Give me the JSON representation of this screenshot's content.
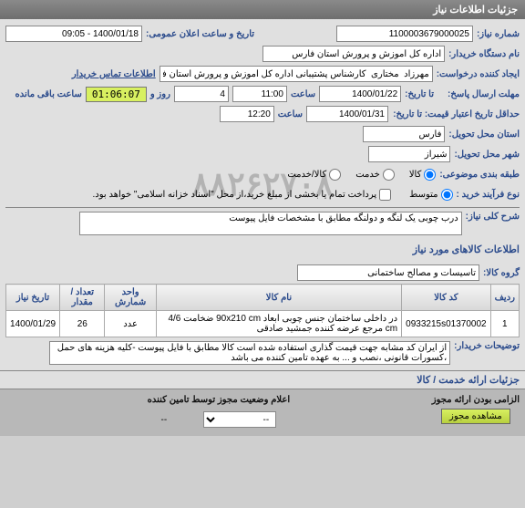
{
  "titlebar": "جزئیات اطلاعات نیاز",
  "need_no_label": "شماره نیاز:",
  "need_no": "1100003679000025",
  "announce_label": "تاریخ و ساعت اعلان عمومی:",
  "announce_value": "1400/01/18 - 09:05",
  "buyer_label": "نام دستگاه خریدار:",
  "buyer_value": "اداره کل آموزش و پرورش استان فارس",
  "creator_label": "ایجاد کننده درخواست:",
  "creator_value": "مهرزاد  مختاری  کارشناس پشتیبانی اداره کل آموزش و پرورش استان فارس",
  "contact_link": "اطلاعات تماس خریدار",
  "deadline_reply_label": "مهلت ارسال پاسخ:",
  "deadline_reply_to_label": "تا تاریخ:",
  "deadline_reply_date": "1400/01/22",
  "time_label": "ساعت",
  "deadline_reply_time": "11:00",
  "deadline_reply_days": "4",
  "days_and_label": "روز و",
  "deadline_reply_clock": "01:06:07",
  "clock_suffix": "ساعت باقی مانده",
  "price_valid_label": "حداقل تاریخ اعتبار قیمت: تا تاریخ:",
  "price_valid_date": "1400/01/31",
  "price_valid_time": "12:20",
  "delivery_state_label": "استان محل تحویل:",
  "delivery_state": "فارس",
  "delivery_city_label": "شهر محل تحویل:",
  "delivery_city": "شیراز",
  "budget_label": "طبقه بندی موضوعی:",
  "budget_goods": "کالا",
  "budget_service": "خدمت",
  "budget_goods_service": "کالا/خدمت",
  "process_label": "نوع فرآیند خرید :",
  "process_mid": "متوسط",
  "partial_pay_label": "پرداخت تمام یا بخشی از مبلغ خرید،از محل \"اسناد خزانه اسلامی\" خواهد بود.",
  "desc_label": "شرح کلی نیاز:",
  "desc_value": "درب چوبی یک لنگه و دولنگه مطابق با مشخصات فایل پیوست",
  "items_header": "اطلاعات کالاهای مورد نیاز",
  "group_label": "گروه کالا:",
  "group_value": "تاسیسات و مصالح ساختمانی",
  "cols": {
    "row": "ردیف",
    "code": "کد کالا",
    "name": "نام کالا",
    "unit": "واحد شمارش",
    "qty": "تعداد / مقدار",
    "need_date": "تاریخ نیاز"
  },
  "rows": [
    {
      "idx": "1",
      "code": "0933215s01370002",
      "name": "در داخلی ساختمان جنس چوبی ابعاد 90x210 cm ضخامت 4/6 cm مرجع عرضه کننده جمشید صادقی",
      "unit": "عدد",
      "qty": "26",
      "need_date": "1400/01/29"
    }
  ],
  "buyer_note_label": "توضیحات خریدار:",
  "buyer_note_value": "از ایران کد مشابه جهت قیمت گذاری استفاده شده است کالا مطابق با فایل پیوست -کلیه هزینه های حمل ،کسورات قانونی ،نصب و ... به عهده تامین کننده می باشد",
  "services_header": "جزئیات ارائه خدمت / کالا",
  "footer_right_label": "الزامی بودن ارائه مجوز",
  "footer_left_label": "اعلام وضعیت مجوز توسط تامین کننده",
  "view_permit_btn": "مشاهده مجوز",
  "dash": "--",
  "watermark": "۸۸۲۶۲۷۰۸"
}
